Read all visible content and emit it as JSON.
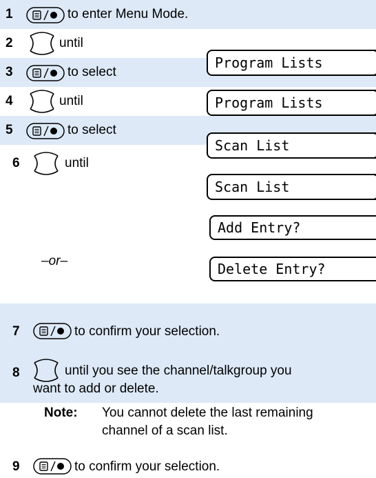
{
  "steps": {
    "s1": {
      "num": "1",
      "text": "to enter Menu Mode."
    },
    "s2": {
      "num": "2",
      "text": "until",
      "display": "Program Lists"
    },
    "s3": {
      "num": "3",
      "text": "to select",
      "display": "Program Lists"
    },
    "s4": {
      "num": "4",
      "text": "until",
      "display": "Scan List"
    },
    "s5": {
      "num": "5",
      "text": "to select",
      "display": "Scan List"
    },
    "s6": {
      "num": "6",
      "text": "until",
      "display": "Add Entry?",
      "or_text": "–or–",
      "or_display": "Delete Entry?"
    },
    "s7": {
      "num": "7",
      "text": "to confirm your selection."
    },
    "s8": {
      "num": "8",
      "text_line1": "until you see the channel/talkgroup you",
      "text_line2": "want to add or delete.",
      "note_label": "Note:",
      "note_line1": "You cannot delete the last remaining",
      "note_line2": "channel of a scan list."
    },
    "s9": {
      "num": "9",
      "text": "to confirm your selection."
    }
  },
  "icons": {
    "menu_select": "menu-select-button-icon",
    "rocker": "up-down-rocker-icon"
  },
  "colors": {
    "band": "#dde9f7"
  }
}
